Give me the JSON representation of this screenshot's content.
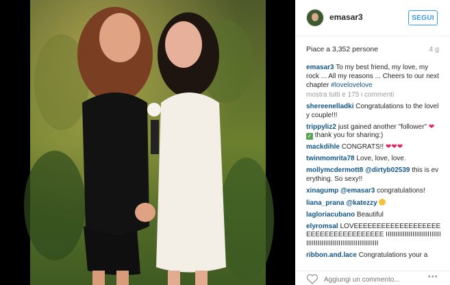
{
  "post": {
    "username": "emasar3",
    "follow_label": "SEGUI",
    "likes": "Piace a 3,352 persone",
    "age": "4 g",
    "caption_user": "emasar3",
    "caption_text": "To my best friend, my love, my rock ... All my reasons ... Cheers to our next chapter",
    "caption_hashtag": "#lovelovelove",
    "more_comments": "mostra tutti e 175 i commenti",
    "comment_placeholder": "Aggiungi un commento..."
  },
  "comments": [
    {
      "user": "shereenelladki",
      "text": "Congratulations to the lovely couple!!!"
    },
    {
      "user": "trippyliz2",
      "text": "just gained another \"follower\"",
      "text2": "thank you for sharing:)"
    },
    {
      "user": "mackdihle",
      "text": "CONGRATS!!",
      "hearts": "❤❤❤"
    },
    {
      "user": "twinmomrita78",
      "text": "Love, love, love."
    },
    {
      "user": "mollymcdermott8",
      "mention": "@dirtyb02539",
      "text": "this is everything. So sexy!!"
    },
    {
      "user": "xinagump",
      "mention": "@emasar3",
      "text": "congratulations!"
    },
    {
      "user": "liana_prana",
      "mention": "@katezzy"
    },
    {
      "user": "lagloriacubano",
      "text": "Beautiful"
    },
    {
      "user": "elyromsal",
      "text": "LOVEEEEEEEEEEEEEEEEEEEEEEEEEEEEEEEEEEEE IIIIIIIIIIIIIIIIIIIIIIIIIIIIIIIIIIIIIIIIIIIIIIIIIIIIIIIIIIIIIIIIIII"
    },
    {
      "user": "ribbon.and.lace",
      "text": "Congratulations your a"
    }
  ],
  "icons": {
    "heart": "heart-icon",
    "more": "ellipsis-icon",
    "avatar": "avatar"
  },
  "colors": {
    "link": "#125688",
    "follow": "#3897f0",
    "heart": "#e0245e"
  }
}
